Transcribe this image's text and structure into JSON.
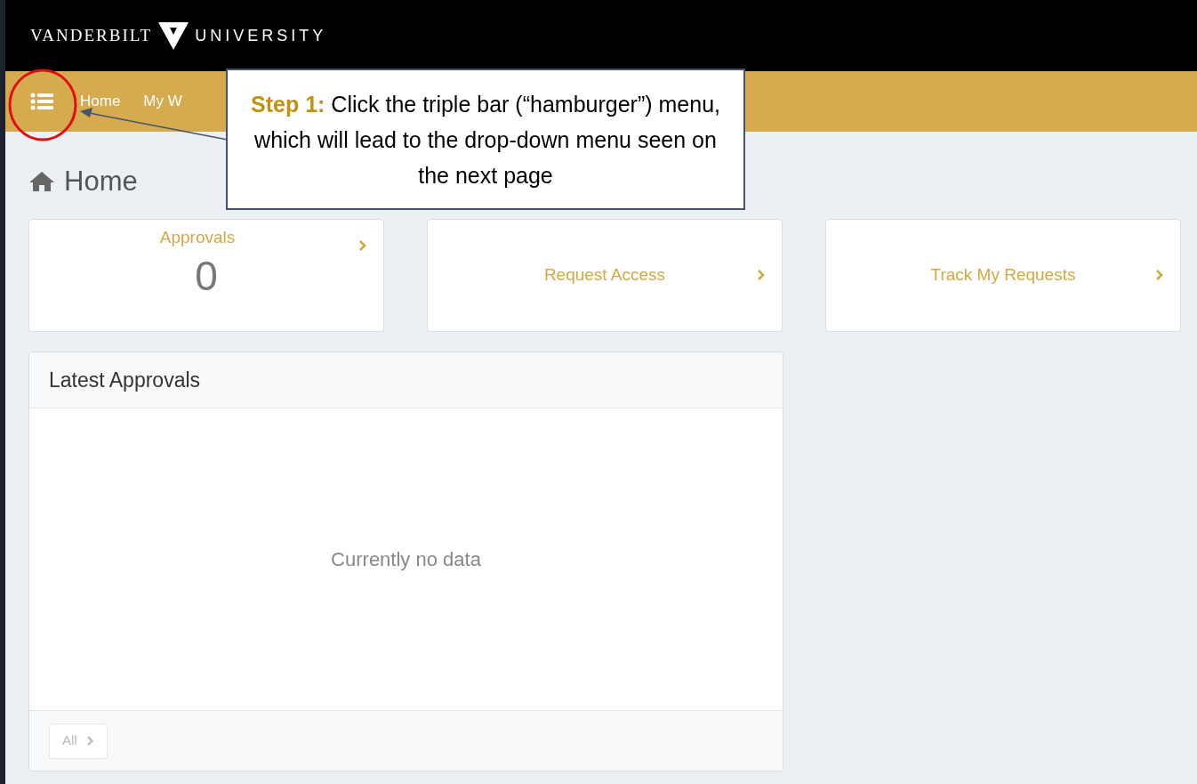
{
  "header": {
    "logo_left": "VANDERBILT",
    "logo_right": "UNIVERSITY"
  },
  "nav": {
    "items": [
      {
        "label": "Home"
      },
      {
        "label": "My W"
      }
    ]
  },
  "page_title": "Home",
  "tiles": [
    {
      "title": "Approvals",
      "count": "0"
    },
    {
      "title": "Request Access"
    },
    {
      "title": "Track My Requests"
    }
  ],
  "panel": {
    "title": "Latest Approvals",
    "empty_text": "Currently no data",
    "footer_button": "All"
  },
  "callout": {
    "step": "Step 1:",
    "text": "Click the triple bar (“hamburger”) menu, which will lead to the drop-down menu seen on the next page"
  }
}
